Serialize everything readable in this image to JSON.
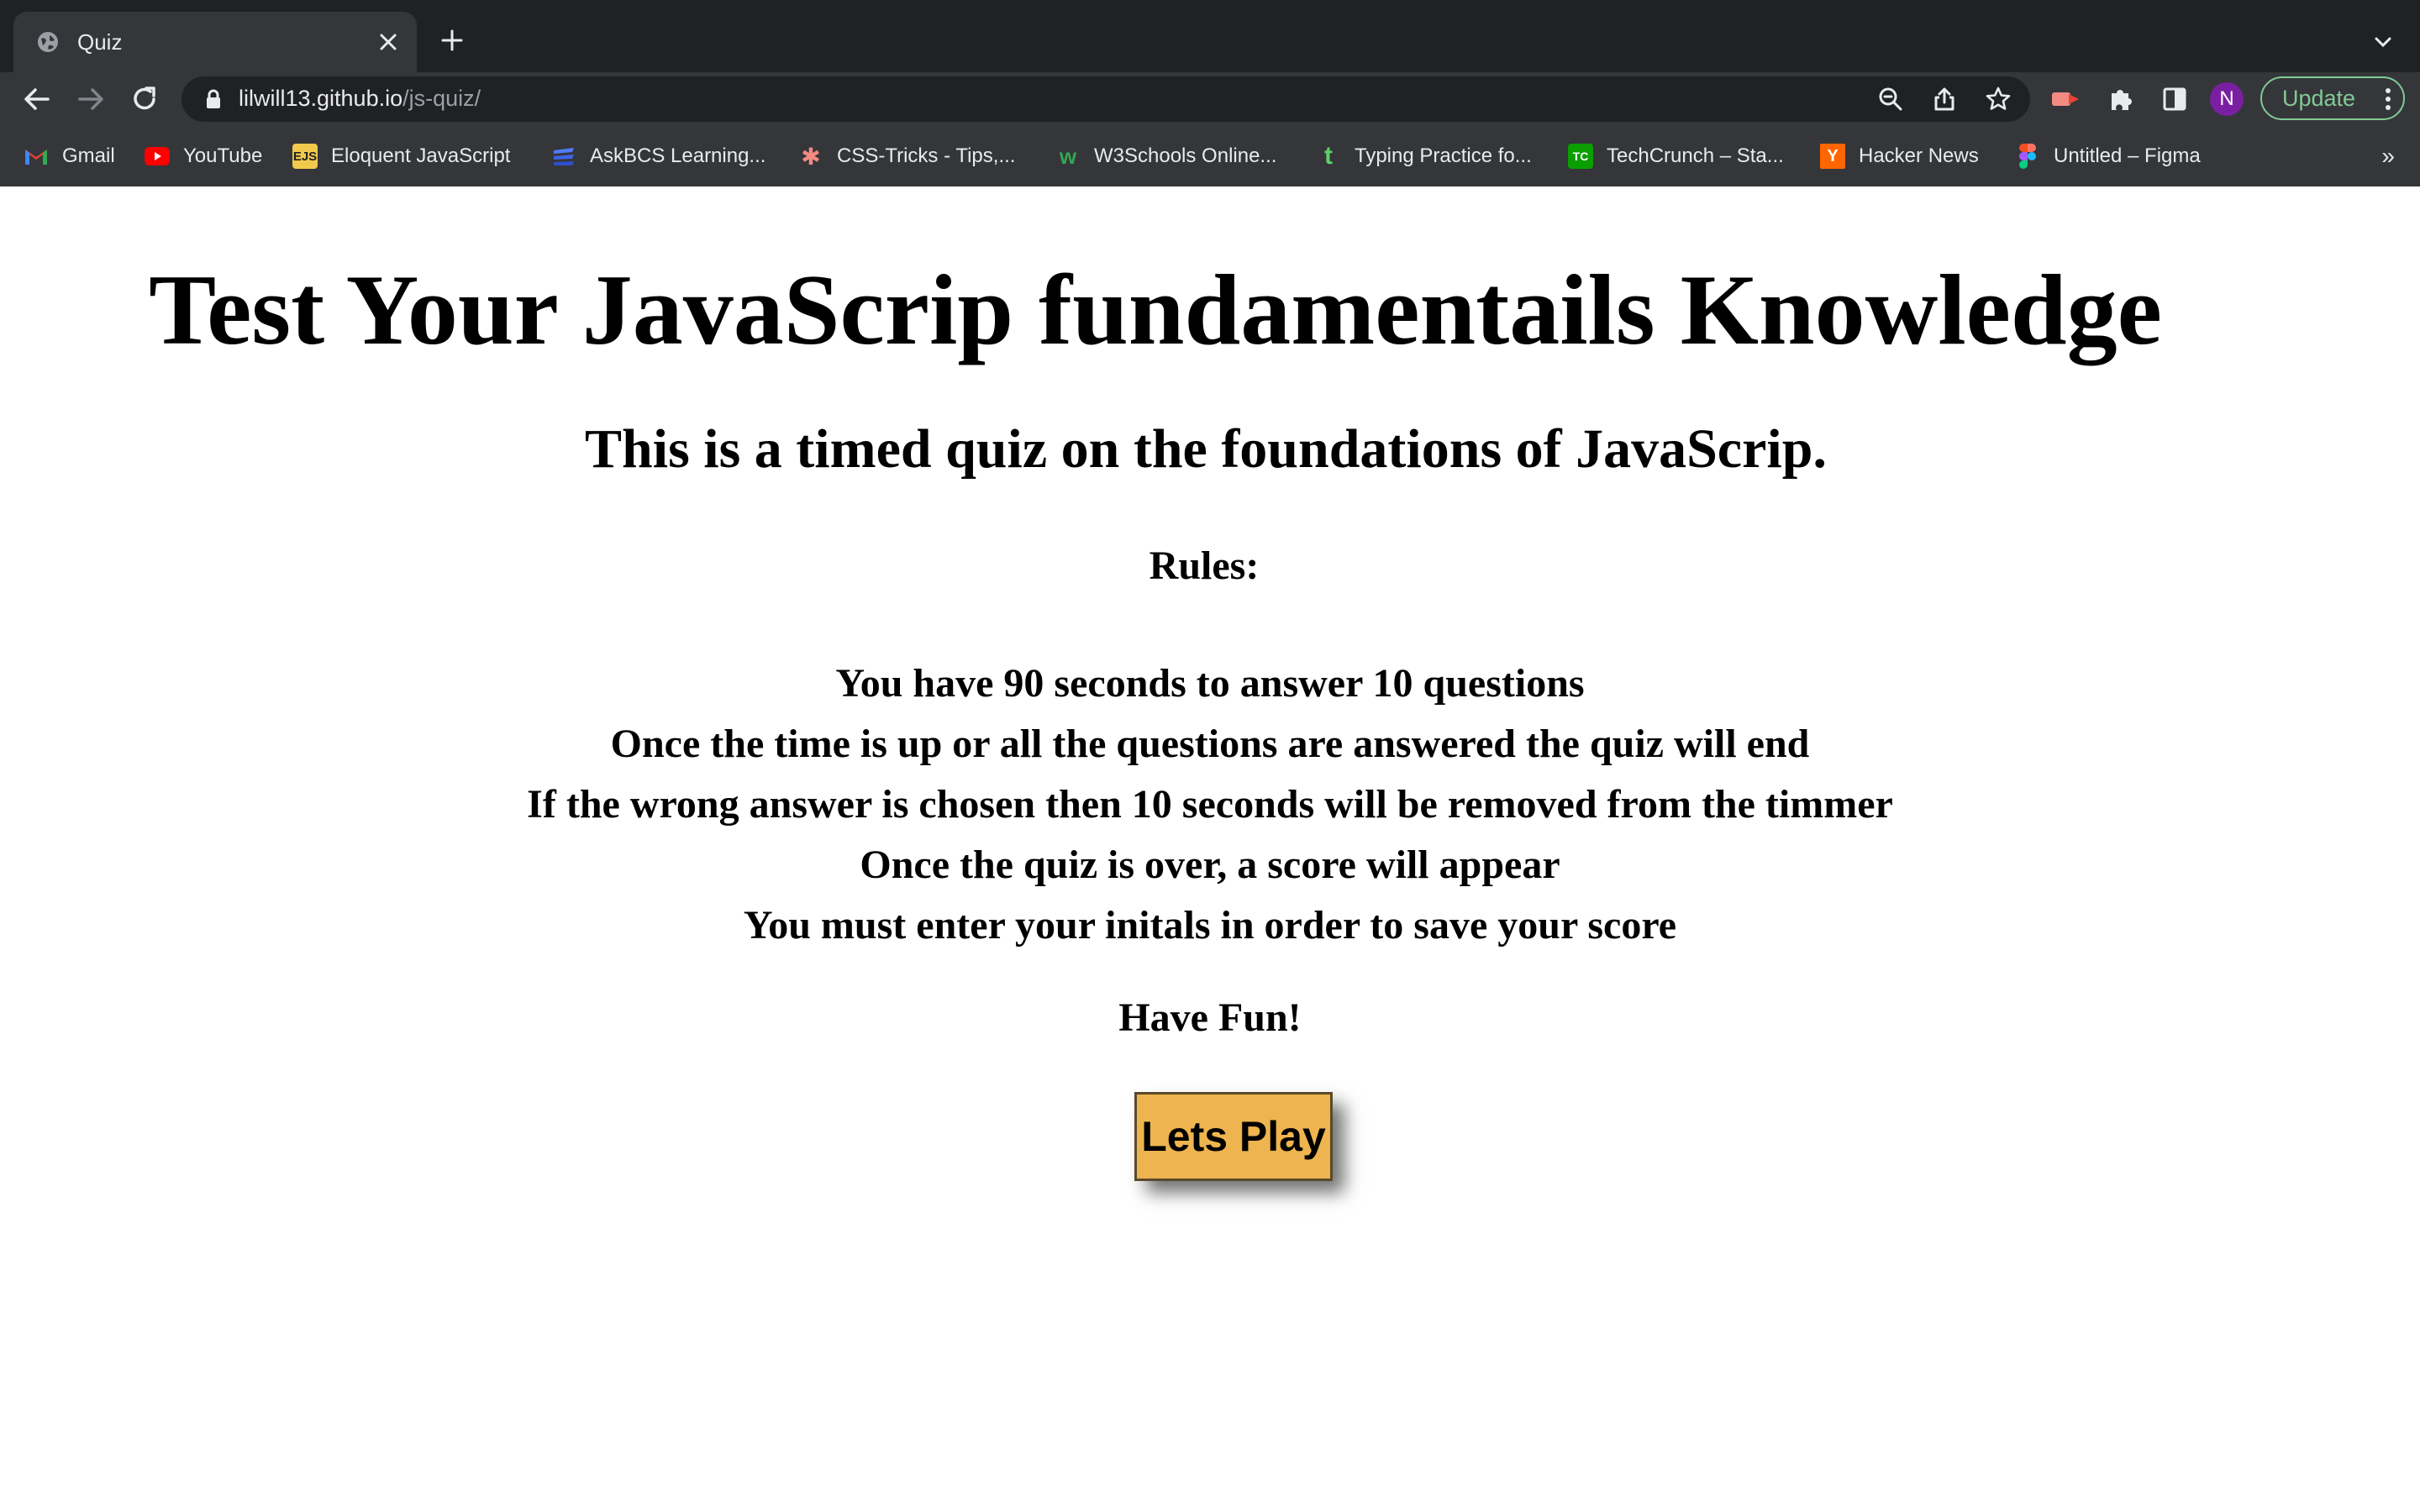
{
  "browser": {
    "tab": {
      "title": "Quiz",
      "favicon": "globe-icon"
    },
    "url": {
      "host": "lilwill13.github.io",
      "path": "/js-quiz/"
    },
    "profile_initial": "N",
    "update_label": "Update",
    "bookmarks": [
      {
        "label": "Gmail",
        "icon": "gmail-icon"
      },
      {
        "label": "YouTube",
        "icon": "youtube-icon"
      },
      {
        "label": "Eloquent JavaScript",
        "icon": "ejs-icon",
        "icon_text": "EJS"
      },
      {
        "label": "AskBCS Learning...",
        "icon": "askbcs-icon"
      },
      {
        "label": "CSS-Tricks - Tips,...",
        "icon": "css-tricks-icon",
        "icon_text": "✱"
      },
      {
        "label": "W3Schools Online...",
        "icon": "w3schools-icon",
        "icon_text": "w"
      },
      {
        "label": "Typing Practice fo...",
        "icon": "typing-icon",
        "icon_text": "t"
      },
      {
        "label": "TechCrunch – Sta...",
        "icon": "techcrunch-icon",
        "icon_text": "TC"
      },
      {
        "label": "Hacker News",
        "icon": "hacker-news-icon",
        "icon_text": "Y"
      },
      {
        "label": "Untitled – Figma",
        "icon": "figma-icon"
      }
    ],
    "more_bookmarks": "»"
  },
  "page": {
    "title": "Test Your JavaScrip fundamentails Knowledge",
    "subtitle": "This is a timed quiz on the foundations of JavaScrip.",
    "rules_heading": "Rules:",
    "rules": [
      "You have 90 seconds to answer 10 questions",
      "Once the time is up or all the questions are answered the quiz will end",
      "If the wrong answer is chosen then 10 seconds will be removed from the timmer",
      "Once the quiz is over, a score will appear",
      "You must enter your initals in order to save your score"
    ],
    "closing": "Have Fun!",
    "play_button": "Lets Play"
  },
  "colors": {
    "tabstrip": "#202124",
    "toolbar": "#35363a",
    "button": "#eeb44f",
    "update": "#81c995",
    "avatar": "#7b1fa2"
  }
}
